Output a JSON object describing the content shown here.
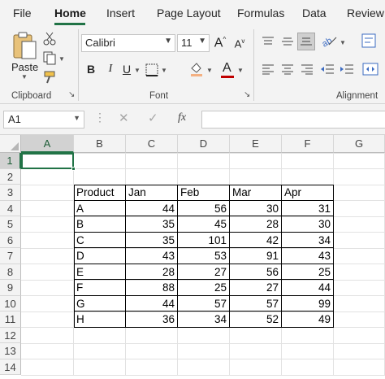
{
  "ribbon_tabs": [
    "File",
    "Home",
    "Insert",
    "Page Layout",
    "Formulas",
    "Data",
    "Review"
  ],
  "active_tab": "Home",
  "clipboard": {
    "paste_label": "Paste",
    "group_label": "Clipboard"
  },
  "font": {
    "font_name": "Calibri",
    "font_size": "11",
    "grow_label": "A",
    "shrink_label": "A",
    "bold": "B",
    "italic": "I",
    "underline": "U",
    "font_color_label": "A",
    "group_label": "Font"
  },
  "alignment": {
    "group_label": "Alignment"
  },
  "formula_bar": {
    "name_box": "A1",
    "fx": "fx",
    "cancel": "✕",
    "enter": "✓",
    "formula": ""
  },
  "accent_color": "#217346",
  "columns": [
    "A",
    "B",
    "C",
    "D",
    "E",
    "F",
    "G"
  ],
  "rows": [
    "1",
    "2",
    "3",
    "4",
    "5",
    "6",
    "7",
    "8",
    "9",
    "10",
    "11",
    "12",
    "13",
    "14"
  ],
  "selected_cell": "A1",
  "table": {
    "headers": [
      "Product",
      "Jan",
      "Feb",
      "Mar",
      "Apr"
    ],
    "rows": [
      [
        "A",
        "44",
        "56",
        "30",
        "31"
      ],
      [
        "B",
        "35",
        "45",
        "28",
        "30"
      ],
      [
        "C",
        "35",
        "101",
        "42",
        "34"
      ],
      [
        "D",
        "43",
        "53",
        "91",
        "43"
      ],
      [
        "E",
        "28",
        "27",
        "56",
        "25"
      ],
      [
        "F",
        "88",
        "25",
        "27",
        "44"
      ],
      [
        "G",
        "44",
        "57",
        "57",
        "99"
      ],
      [
        "H",
        "36",
        "34",
        "52",
        "49"
      ]
    ]
  }
}
